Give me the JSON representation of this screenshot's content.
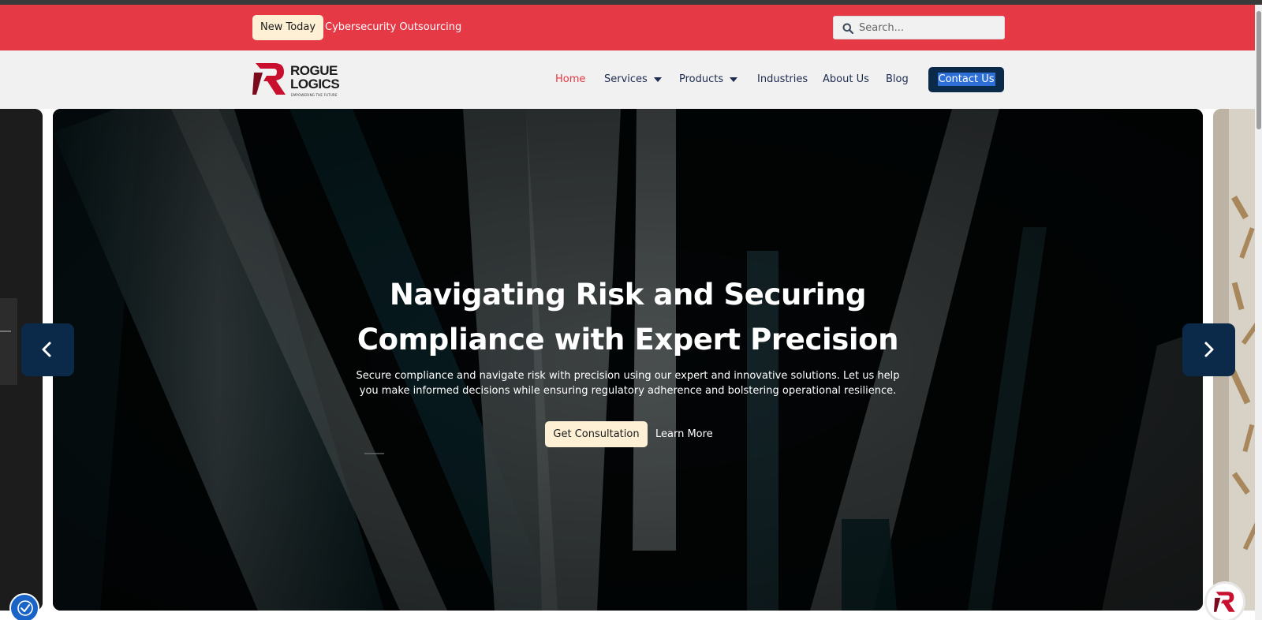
{
  "announcement": {
    "badge": "New Today",
    "link": "Cybersecurity Outsourcing"
  },
  "search": {
    "placeholder": "Search..."
  },
  "brand": {
    "name_line1": "ROGUE",
    "name_line2": "LOGICS",
    "tagline": "EMPOWERING THE FUTURE"
  },
  "nav": {
    "home": "Home",
    "services": "Services",
    "products": "Products",
    "industries": "Industries",
    "about": "About Us",
    "blog": "Blog",
    "contact": "Contact Us"
  },
  "hero": {
    "title_line1": "Navigating Risk and Securing",
    "title_line2": "Compliance with Expert Precision",
    "description": "Secure compliance and navigate risk with precision using our expert and innovative solutions. Let us help you make informed decisions while ensuring regulatory adherence and bolstering operational resilience.",
    "primary_cta": "Get Consultation",
    "secondary_cta": "Learn More"
  },
  "colors": {
    "brand_red": "#e63946",
    "navy": "#0b2a4a",
    "cream": "#fdf0d5",
    "nav_text": "#1d2b4f"
  },
  "icons": {
    "search": "search-icon",
    "prev": "chevron-left-icon",
    "next": "chevron-right-icon",
    "accessibility": "accessibility-icon",
    "chat": "chat-logo-icon"
  }
}
